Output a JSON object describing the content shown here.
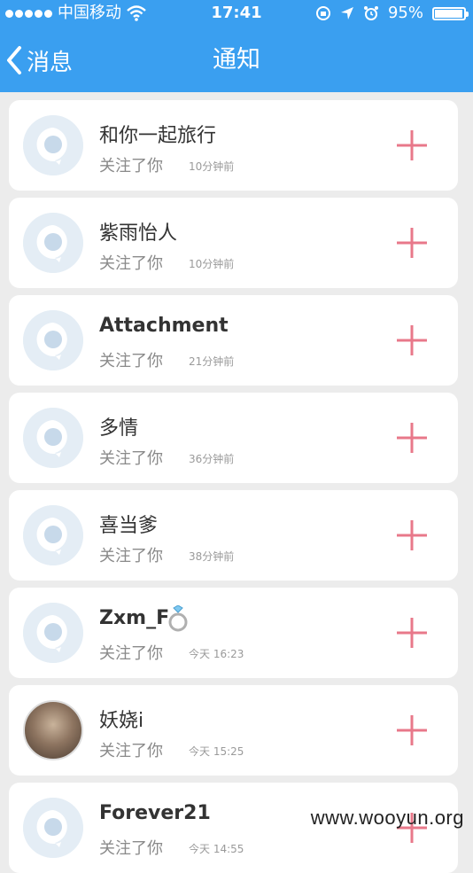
{
  "status_bar": {
    "carrier": "中国移动",
    "time": "17:41",
    "battery": "95%",
    "battery_level": 0.95
  },
  "nav": {
    "back_label": "消息",
    "title": "通知"
  },
  "notifications": [
    {
      "name": "和你一起旅行",
      "action": "关注了你",
      "time": "10分钟前",
      "avatar": "default-avatar"
    },
    {
      "name": "紫雨怡人",
      "action": "关注了你",
      "time": "10分钟前",
      "avatar": "default-avatar"
    },
    {
      "name": "Attachment",
      "action": "关注了你",
      "time": "21分钟前",
      "avatar": "default-avatar"
    },
    {
      "name": "多情",
      "action": "关注了你",
      "time": "36分钟前",
      "avatar": "default-avatar"
    },
    {
      "name": "喜当爹",
      "action": "关注了你",
      "time": "38分钟前",
      "avatar": "default-avatar"
    },
    {
      "name": "Zxm_F",
      "action": "关注了你",
      "time": "今天 16:23",
      "avatar": "default-avatar"
    },
    {
      "name": "妖娆i",
      "action": "关注了你",
      "time": "今天 15:25",
      "avatar": "photo-avatar"
    },
    {
      "name": "Forever21",
      "action": "关注了你",
      "time": "今天 14:55",
      "avatar": "default-avatar"
    }
  ],
  "colors": {
    "accent": "#3a9ff0",
    "add_icon": "#e8788a"
  },
  "watermark": "www.wooyun.org"
}
